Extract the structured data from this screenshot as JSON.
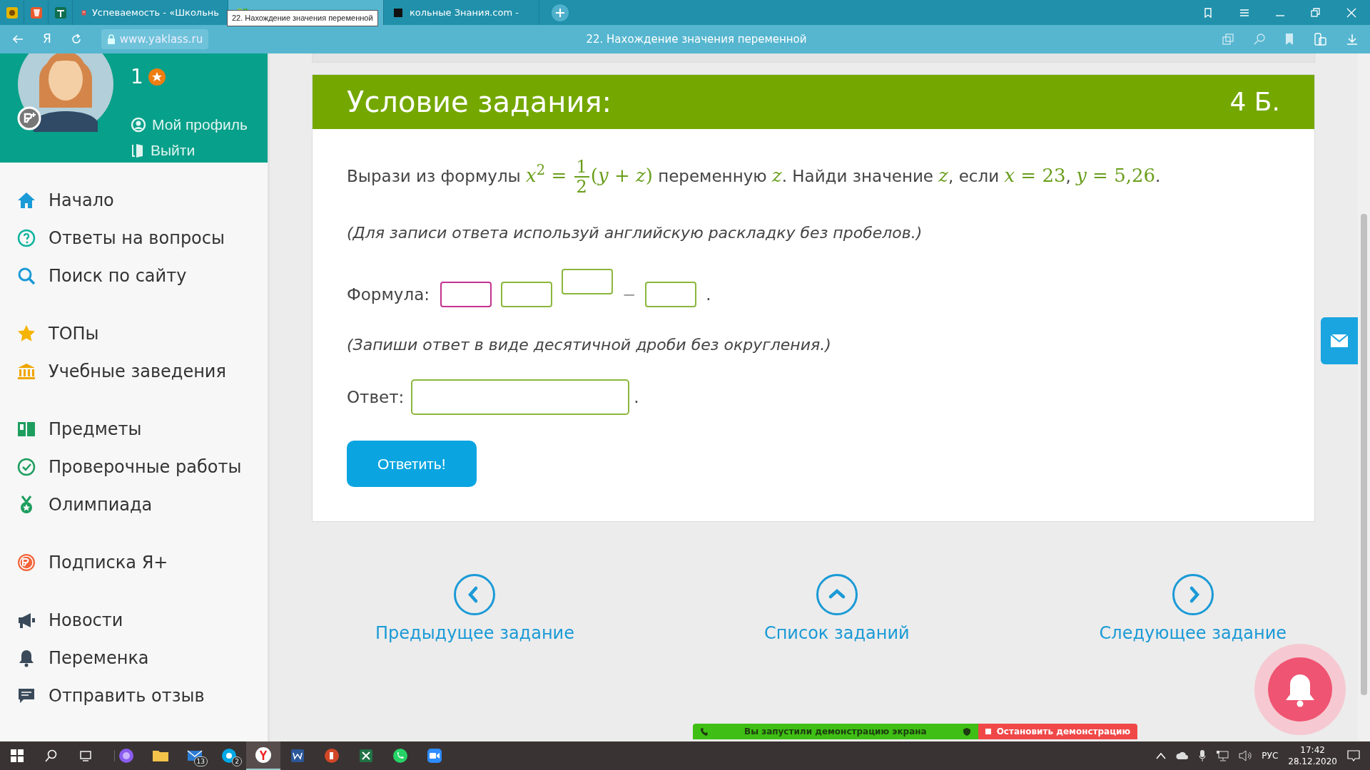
{
  "browser": {
    "tabs": [
      {
        "selected": false
      },
      {
        "selected": false
      },
      {
        "selected": false
      },
      {
        "title": "Успеваемость - «Школьнь",
        "selected": false
      },
      {
        "selected": true
      },
      {
        "title": "кольные Знания.com -",
        "selected": false
      }
    ],
    "tooltip": "22. Нахождение значения переменной",
    "address": "www.yaklass.ru",
    "back_letter": "Я",
    "page_title": "22. Нахождение значения переменной"
  },
  "profile": {
    "points": "1",
    "links": [
      "Мой профиль",
      "Выйти"
    ]
  },
  "sidebar": {
    "groups": [
      [
        {
          "label": "Начало"
        },
        {
          "label": "Ответы на вопросы"
        },
        {
          "label": "Поиск по сайту"
        }
      ],
      [
        {
          "label": "ТОПы"
        },
        {
          "label": "Учебные заведения"
        }
      ],
      [
        {
          "label": "Предметы"
        },
        {
          "label": "Проверочные работы"
        },
        {
          "label": "Олимпиада"
        }
      ],
      [
        {
          "label": "Подписка Я+"
        }
      ],
      [
        {
          "label": "Новости"
        },
        {
          "label": "Переменка"
        },
        {
          "label": "Отправить отзыв"
        }
      ]
    ]
  },
  "task": {
    "header": "Условие задания:",
    "score": "4 Б.",
    "statement": [
      {
        "kind": "text",
        "text": "Вырази из формулы "
      },
      {
        "kind": "math",
        "text": "*x*$^{2}$ = "
      },
      {
        "kind": "fraction",
        "numerator": "1",
        "denominator": "2"
      },
      {
        "kind": "math",
        "text": "(*y* + *z*)"
      },
      {
        "kind": "text",
        "text": " переменную "
      },
      {
        "kind": "math",
        "text": "*z*"
      },
      {
        "kind": "text",
        "text": ". Найди значение "
      },
      {
        "kind": "math",
        "text": "*z*"
      },
      {
        "kind": "text",
        "text": ", если "
      },
      {
        "kind": "math",
        "text": "*x* = 23"
      },
      {
        "kind": "text",
        "text": ", "
      },
      {
        "kind": "math",
        "text": "*y* = 5,26"
      },
      {
        "kind": "text",
        "text": "."
      }
    ],
    "hint1": "(Для записи ответа используй английскую раскладку без пробелов.)",
    "formula": {
      "label": "Формула:",
      "items": [
        {
          "kind": "field",
          "focused": true
        },
        {
          "kind": "field",
          "focused": false
        },
        {
          "kind": "raised-field",
          "focused": false
        },
        {
          "kind": "sign",
          "text": "−"
        },
        {
          "kind": "field",
          "focused": false
        },
        {
          "kind": "sign",
          "text": "."
        }
      ]
    },
    "hint2": "(Запиши ответ в виде десятичной дроби без округления.)",
    "answer": {
      "label": "Ответ:",
      "suffix": "."
    },
    "submit": "Ответить!"
  },
  "nav": [
    {
      "label": "Предыдущее задание"
    },
    {
      "label": "Список заданий"
    },
    {
      "label": "Следующее задание"
    }
  ],
  "demo_bar": {
    "message": "Вы запустили демонстрацию экрана",
    "stop": "Остановить демонстрацию"
  },
  "taskbar": {
    "apps": [
      {
        "selected": false
      },
      {
        "selected": false
      },
      {
        "selected": false,
        "badge": "13"
      },
      {
        "selected": false,
        "badge": "2"
      },
      {
        "selected": true
      },
      {
        "selected": false
      },
      {
        "selected": false
      },
      {
        "selected": false
      },
      {
        "selected": false
      },
      {
        "selected": false
      }
    ],
    "language": "РУС",
    "time": "17:42",
    "date": "28.12.2020"
  }
}
